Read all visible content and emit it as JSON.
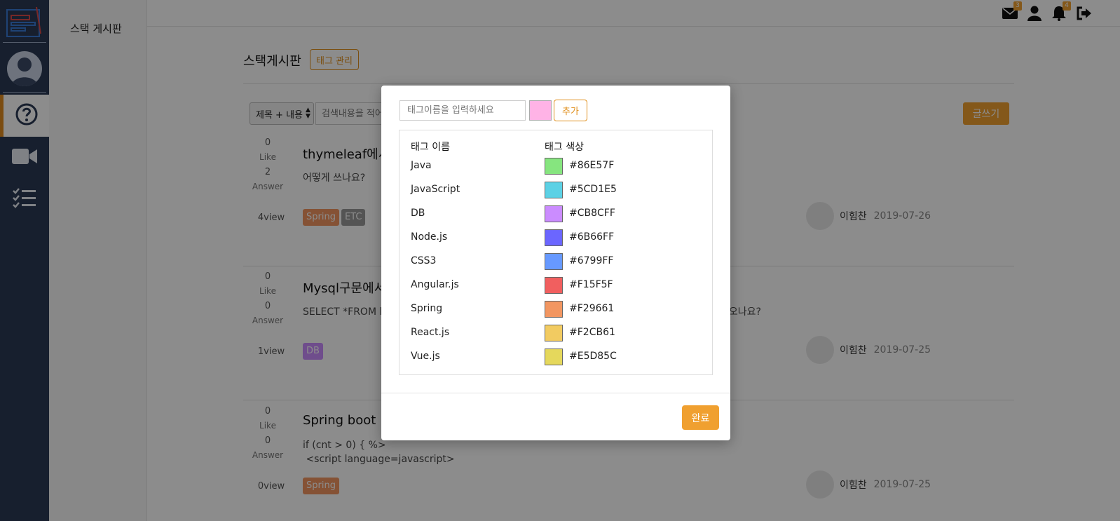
{
  "sidebar": {
    "logo_icon": "board-logo-icon",
    "profile_icon": "user-avatar-icon",
    "items": [
      {
        "icon": "question-circle-icon",
        "active": true
      },
      {
        "icon": "video-camera-icon",
        "active": false
      },
      {
        "icon": "checklist-icon",
        "active": false
      }
    ]
  },
  "subnav": {
    "item": "스택 게시판"
  },
  "topbar": {
    "mail_badge": "3",
    "bell_badge": "4",
    "icons": [
      "mail-icon",
      "user-icon",
      "bell-icon",
      "logout-icon"
    ]
  },
  "main": {
    "title": "스택게시판",
    "tag_manage_label": "태그 관리",
    "search_option": "제목 + 내용",
    "search_placeholder": "검색내용을 적어",
    "write_label": "글쓰기"
  },
  "posts": [
    {
      "likes": "0",
      "likes_label": "Like",
      "answers": "2",
      "answers_label": "Answer",
      "title": "thymeleaf에서",
      "body": "어떻게 쓰나요?",
      "views": "4view",
      "tags": [
        {
          "name": "Spring",
          "color": "#F29661"
        },
        {
          "name": "ETC",
          "color": "#999999"
        }
      ],
      "author": "이힘찬",
      "date": "2019-07-26"
    },
    {
      "likes": "0",
      "likes_label": "Like",
      "answers": "0",
      "answers_label": "Answer",
      "title": "Mysql구문에서",
      "body": "SELECT *FROM li",
      "body_tail": "나오나요?",
      "views": "1view",
      "tags": [
        {
          "name": "DB",
          "color": "#CB8CFF"
        }
      ],
      "author": "이힘찬",
      "date": "2019-07-25"
    },
    {
      "likes": "0",
      "likes_label": "Like",
      "answers": "0",
      "answers_label": "Answer",
      "title": "Spring boot",
      "body": "if (cnt > 0) { %>\n <script language=javascript>",
      "views": "0view",
      "tags": [
        {
          "name": "Spring",
          "color": "#F29661"
        }
      ],
      "author": "이힘찬",
      "date": "2019-07-25"
    }
  ],
  "modal": {
    "tag_input_placeholder": "태그이름을 입력하세요",
    "picker_color": "#FFB3E6",
    "add_label": "추가",
    "col_name": "태그 이름",
    "col_color": "태그 색상",
    "tags": [
      {
        "name": "Java",
        "hex": "#86E57F"
      },
      {
        "name": "JavaScript",
        "hex": "#5CD1E5"
      },
      {
        "name": "DB",
        "hex": "#CB8CFF"
      },
      {
        "name": "Node.js",
        "hex": "#6B66FF"
      },
      {
        "name": "CSS3",
        "hex": "#6799FF"
      },
      {
        "name": "Angular.js",
        "hex": "#F15F5F"
      },
      {
        "name": "Spring",
        "hex": "#F29661"
      },
      {
        "name": "React.js",
        "hex": "#F2CB61"
      },
      {
        "name": "Vue.js",
        "hex": "#E5D85C"
      }
    ],
    "done_label": "완료"
  }
}
